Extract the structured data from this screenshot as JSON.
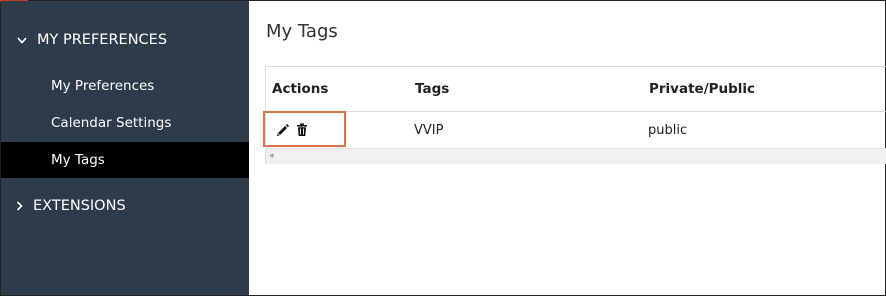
{
  "sidebar": {
    "sections": [
      {
        "label": "MY PREFERENCES",
        "expanded": true,
        "icon": "chevron-down-icon",
        "items": [
          {
            "label": "My Preferences",
            "active": false
          },
          {
            "label": "Calendar Settings",
            "active": false
          },
          {
            "label": "My Tags",
            "active": true
          }
        ]
      },
      {
        "label": "EXTENSIONS",
        "expanded": false,
        "icon": "chevron-right-icon"
      }
    ]
  },
  "main": {
    "title": "My Tags",
    "table": {
      "columns": [
        "Actions",
        "Tags",
        "Private/Public"
      ],
      "rows": [
        {
          "actions": [
            "edit-pencil-icon",
            "delete-trash-icon"
          ],
          "tag": "VVIP",
          "visibility": "public"
        }
      ]
    }
  },
  "colors": {
    "sidebar_bg": "#2e3b4a",
    "active_item_bg": "#000000",
    "highlight_border": "#d9764a"
  }
}
